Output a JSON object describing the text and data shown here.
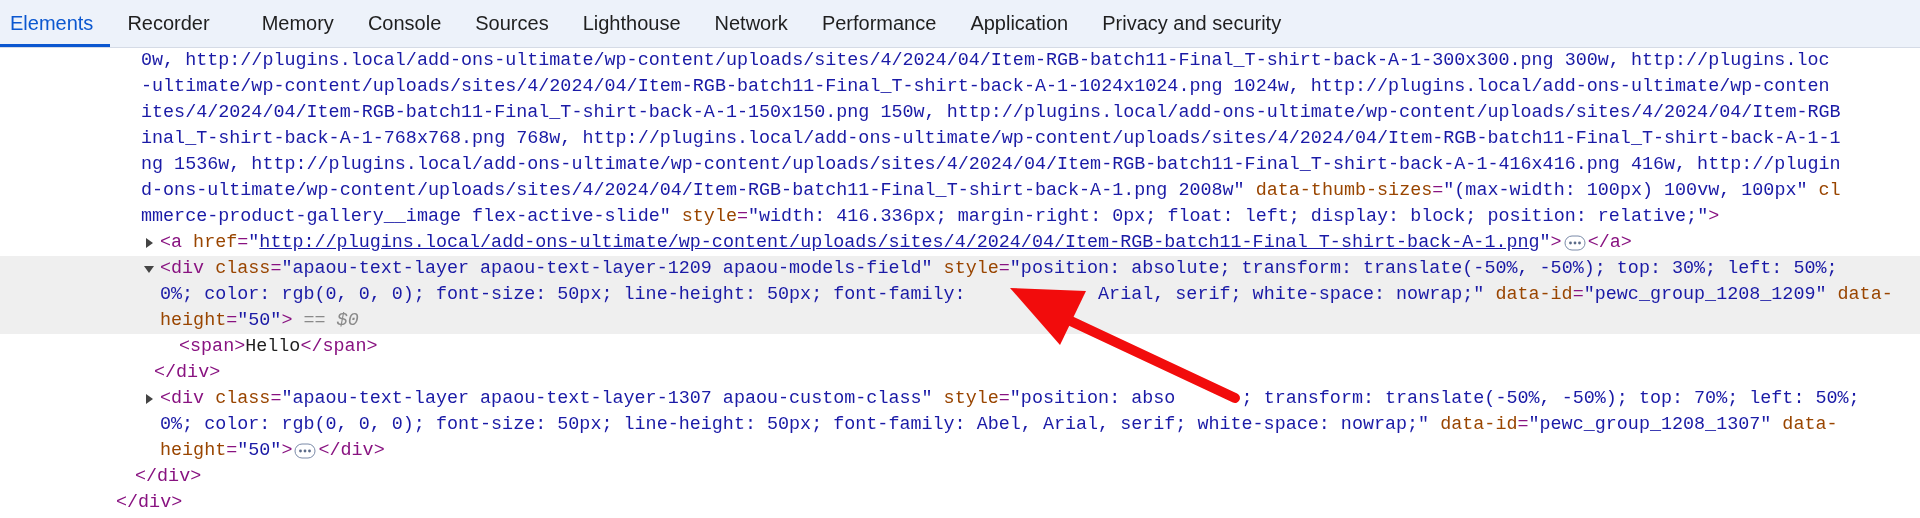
{
  "tabs": [
    {
      "label": "Elements",
      "selected": true
    },
    {
      "label": "Recorder",
      "selected": false
    },
    {
      "label": "Memory",
      "selected": false
    },
    {
      "label": "Console",
      "selected": false
    },
    {
      "label": "Sources",
      "selected": false
    },
    {
      "label": "Lighthouse",
      "selected": false
    },
    {
      "label": "Network",
      "selected": false
    },
    {
      "label": "Performance",
      "selected": false
    },
    {
      "label": "Application",
      "selected": false
    },
    {
      "label": "Privacy and security",
      "selected": false
    }
  ],
  "tree": [
    {
      "selected": false,
      "closing": "</div>",
      "children": [
        {
          "selected": false,
          "lines": [
            [
              {
                "kind": "value",
                "text": "0w, http://plugins.local/add-ons-ultimate/wp-content/uploads/sites/4/2024/04/Item-RGB-batch11-Final_T-shirt-back-A-1-300x300.png 300w, http://plugins.loc"
              }
            ],
            [
              {
                "kind": "value",
                "text": "-ultimate/wp-content/uploads/sites/4/2024/04/Item-RGB-batch11-Final_T-shirt-back-A-1-1024x1024.png 1024w, http://plugins.local/add-ons-ultimate/wp-conten"
              }
            ],
            [
              {
                "kind": "value",
                "text": "ites/4/2024/04/Item-RGB-batch11-Final_T-shirt-back-A-1-150x150.png 150w, http://plugins.local/add-ons-ultimate/wp-content/uploads/sites/4/2024/04/Item-RGB"
              }
            ],
            [
              {
                "kind": "value",
                "text": "inal_T-shirt-back-A-1-768x768.png 768w, http://plugins.local/add-ons-ultimate/wp-content/uploads/sites/4/2024/04/Item-RGB-batch11-Final_T-shirt-back-A-1-1"
              }
            ],
            [
              {
                "kind": "value",
                "text": "ng 1536w, http://plugins.local/add-ons-ultimate/wp-content/uploads/sites/4/2024/04/Item-RGB-batch11-Final_T-shirt-back-A-1-416x416.png 416w, http://plugin"
              }
            ],
            [
              {
                "kind": "value",
                "text": "d-ons-ultimate/wp-content/uploads/sites/4/2024/04/Item-RGB-batch11-Final_T-shirt-back-A-1.png 2008w\""
              },
              {
                "kind": "attr",
                "text": " data-thumb-sizes"
              },
              {
                "kind": "tag",
                "text": "="
              },
              {
                "kind": "value",
                "text": "\"(max-width: 100px) 100vw, 100px\""
              },
              {
                "kind": "attr",
                "text": " cl"
              }
            ],
            [
              {
                "kind": "value",
                "text": "mmerce-product-gallery__image flex-active-slide\""
              },
              {
                "kind": "attr",
                "text": " style"
              },
              {
                "kind": "tag",
                "text": "="
              },
              {
                "kind": "value",
                "text": "\"width: 416.336px; margin-right: 0px; float: left; display: block; position: relative;\""
              },
              {
                "kind": "tag",
                "text": ">"
              }
            ]
          ],
          "closing": "</div>",
          "children": [
            {
              "selected": false,
              "expanded": false,
              "lines": [
                [
                  {
                    "kind": "tag",
                    "text": "<a"
                  },
                  {
                    "kind": "attr",
                    "text": " href"
                  },
                  {
                    "kind": "tag",
                    "text": "="
                  },
                  {
                    "kind": "value",
                    "text": "\""
                  },
                  {
                    "kind": "link",
                    "text": "http://plugins.local/add-ons-ultimate/wp-content/uploads/sites/4/2024/04/Item-RGB-batch11-Final_T-shirt-back-A-1.png"
                  },
                  {
                    "kind": "value",
                    "text": "\""
                  },
                  {
                    "kind": "tag",
                    "text": ">"
                  },
                  {
                    "kind": "more"
                  },
                  {
                    "kind": "tag",
                    "text": "</a>"
                  }
                ]
              ]
            },
            {
              "selected": true,
              "expanded": true,
              "lines": [
                [
                  {
                    "kind": "tag",
                    "text": "<div"
                  },
                  {
                    "kind": "attr",
                    "text": " class"
                  },
                  {
                    "kind": "tag",
                    "text": "="
                  },
                  {
                    "kind": "value",
                    "text": "\"apaou-text-layer apaou-text-layer-1209 apaou-models-field\""
                  },
                  {
                    "kind": "attr",
                    "text": " style"
                  },
                  {
                    "kind": "tag",
                    "text": "="
                  },
                  {
                    "kind": "value",
                    "text": "\"position: absolute; transform: translate(-50%, -50%); top: 30%; left: 50%;"
                  }
                ],
                [
                  {
                    "kind": "value",
                    "text": "0%; color: rgb(0, 0, 0); font-size: 50px; line-height: 50px; font-family:"
                  },
                  {
                    "kind": "covered"
                  },
                  {
                    "kind": "value",
                    "text": " Arial, serif; white-space: nowrap;\""
                  },
                  {
                    "kind": "attr",
                    "text": " data-id"
                  },
                  {
                    "kind": "tag",
                    "text": "="
                  },
                  {
                    "kind": "value",
                    "text": "\"pewc_group_1208_1209\""
                  },
                  {
                    "kind": "attr",
                    "text": " data-"
                  }
                ],
                [
                  {
                    "kind": "attr",
                    "text": "height"
                  },
                  {
                    "kind": "tag",
                    "text": "="
                  },
                  {
                    "kind": "value",
                    "text": "\"50\""
                  },
                  {
                    "kind": "tag",
                    "text": ">"
                  },
                  {
                    "kind": "muted",
                    "text": " == $0"
                  }
                ]
              ],
              "closing": "</div>",
              "children": [
                {
                  "selected": false,
                  "lines": [
                    [
                      {
                        "kind": "tag",
                        "text": "<span>"
                      },
                      {
                        "kind": "text",
                        "text": "Hello"
                      },
                      {
                        "kind": "tag",
                        "text": "</span>"
                      }
                    ]
                  ]
                }
              ]
            },
            {
              "selected": false,
              "expanded": false,
              "lines": [
                [
                  {
                    "kind": "tag",
                    "text": "<div"
                  },
                  {
                    "kind": "attr",
                    "text": " class"
                  },
                  {
                    "kind": "tag",
                    "text": "="
                  },
                  {
                    "kind": "value",
                    "text": "\"apaou-text-layer apaou-text-layer-1307 apaou-custom-class\""
                  },
                  {
                    "kind": "attr",
                    "text": " style"
                  },
                  {
                    "kind": "tag",
                    "text": "="
                  },
                  {
                    "kind": "value",
                    "text": "\"position: abso"
                  },
                  {
                    "kind": "covered"
                  },
                  {
                    "kind": "value",
                    "text": "; transform: translate(-50%, -50%); top: 70%; left: 50%;"
                  }
                ],
                [
                  {
                    "kind": "value",
                    "text": "0%; color: rgb(0, 0, 0); font-size: 50px; line-height: 50px; font-family: Abel, Arial, serif; white-space: nowrap;\""
                  },
                  {
                    "kind": "attr",
                    "text": " data-id"
                  },
                  {
                    "kind": "tag",
                    "text": "="
                  },
                  {
                    "kind": "value",
                    "text": "\"pewc_group_1208_1307\""
                  },
                  {
                    "kind": "attr",
                    "text": " data-"
                  }
                ],
                [
                  {
                    "kind": "attr",
                    "text": "height"
                  },
                  {
                    "kind": "tag",
                    "text": "="
                  },
                  {
                    "kind": "value",
                    "text": "\"50\""
                  },
                  {
                    "kind": "tag",
                    "text": ">"
                  },
                  {
                    "kind": "more"
                  },
                  {
                    "kind": "tag",
                    "text": "</div>"
                  }
                ]
              ]
            }
          ]
        }
      ]
    }
  ]
}
